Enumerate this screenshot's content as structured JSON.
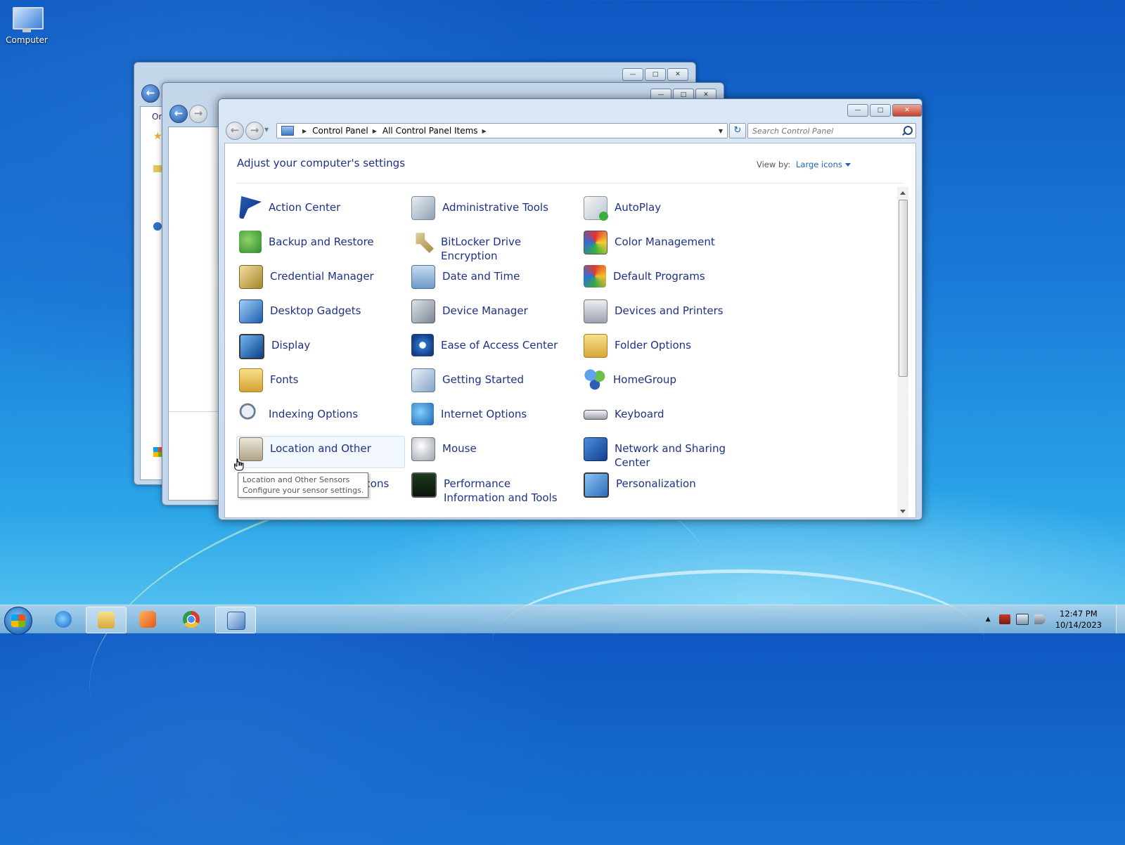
{
  "desktop": {
    "icon_label": "Computer"
  },
  "main_window": {
    "breadcrumb": [
      "Control Panel",
      "All Control Panel Items"
    ],
    "search_placeholder": "Search Control Panel",
    "page_title": "Adjust your computer's settings",
    "view_by_label": "View by:",
    "view_by_value": "Large icons",
    "items": [
      {
        "label": "Action Center",
        "icon": "flag-icon"
      },
      {
        "label": "Administrative Tools",
        "icon": "admin-tools-icon"
      },
      {
        "label": "AutoPlay",
        "icon": "autoplay-icon"
      },
      {
        "label": "Backup and Restore",
        "icon": "backup-icon"
      },
      {
        "label": "BitLocker Drive Encryption",
        "icon": "key-icon"
      },
      {
        "label": "Color Management",
        "icon": "color-management-icon"
      },
      {
        "label": "Credential Manager",
        "icon": "vault-icon"
      },
      {
        "label": "Date and Time",
        "icon": "calendar-clock-icon"
      },
      {
        "label": "Default Programs",
        "icon": "default-programs-icon"
      },
      {
        "label": "Desktop Gadgets",
        "icon": "gadgets-icon"
      },
      {
        "label": "Device Manager",
        "icon": "device-manager-icon"
      },
      {
        "label": "Devices and Printers",
        "icon": "printer-icon"
      },
      {
        "label": "Display",
        "icon": "display-icon"
      },
      {
        "label": "Ease of Access Center",
        "icon": "ease-of-access-icon"
      },
      {
        "label": "Folder Options",
        "icon": "folder-icon"
      },
      {
        "label": "Fonts",
        "icon": "fonts-icon"
      },
      {
        "label": "Getting Started",
        "icon": "getting-started-icon"
      },
      {
        "label": "HomeGroup",
        "icon": "homegroup-icon"
      },
      {
        "label": "Indexing Options",
        "icon": "indexing-icon"
      },
      {
        "label": "Internet Options",
        "icon": "internet-icon"
      },
      {
        "label": "Keyboard",
        "icon": "keyboard-icon"
      },
      {
        "label": "Location and Other",
        "icon": "location-sensor-icon"
      },
      {
        "label": "Mouse",
        "icon": "mouse-icon"
      },
      {
        "label": "Network and Sharing Center",
        "icon": "network-icon"
      },
      {
        "label": "Notification Area Icons",
        "icon": "notification-icon"
      },
      {
        "label": "Performance Information and Tools",
        "icon": "performance-icon"
      },
      {
        "label": "Personalization",
        "icon": "personalization-icon"
      }
    ],
    "tooltip": {
      "line1": "Location and Other Sensors",
      "line2": "Configure your sensor settings."
    }
  },
  "background_windows": {
    "partial_text": "Or"
  },
  "taskbar": {
    "clock_time": "12:47 PM",
    "clock_date": "10/14/2023"
  }
}
